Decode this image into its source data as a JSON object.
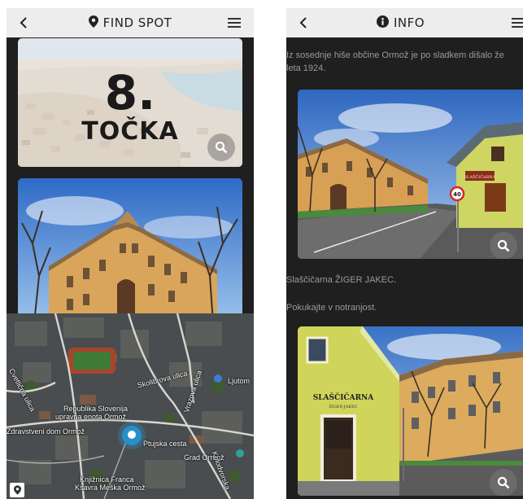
{
  "left_screen": {
    "title": "FIND SPOT",
    "hero_number": "8.",
    "hero_word": "TOČKA",
    "map_labels": {
      "skolibrova": "Skolibrova ulica",
      "vrazova": "Vrazova ulica",
      "ljuto": "Ljutom",
      "republika": "Republika Slovenija",
      "upravna": "upravna enota Ormož",
      "zdravstveni": "Zdravstveni dom Ormož",
      "ptujska": "Ptujska cesta",
      "grad": "Grad Ormož",
      "knjiznica1": "Knjižnica Franca",
      "knjiznica2": "Ksavra Meška Ormož",
      "cvetlicna": "Cvetlična ulica",
      "kolodvorska": "Kolodvorska"
    }
  },
  "right_screen": {
    "title": "INFO",
    "intro_line1": "Iz sosednje hiše občine Ormož je po sladkem dišalo že",
    "intro_line2": "leta 1924.",
    "caption1": "Slaščičarna ŽIGER JAKEC.",
    "caption2": "Pokukajte v notranjost.",
    "shop_sign": "SLAŠČIČARNA",
    "shop_sign_sub": "ŽIGER JAKEC",
    "speed_sign": "40"
  },
  "colors": {
    "topbar_bg": "#ededed",
    "screen_bg": "#1f1f1f",
    "text_muted": "#9a9a9a",
    "pin_blue": "#2a8fc9"
  }
}
